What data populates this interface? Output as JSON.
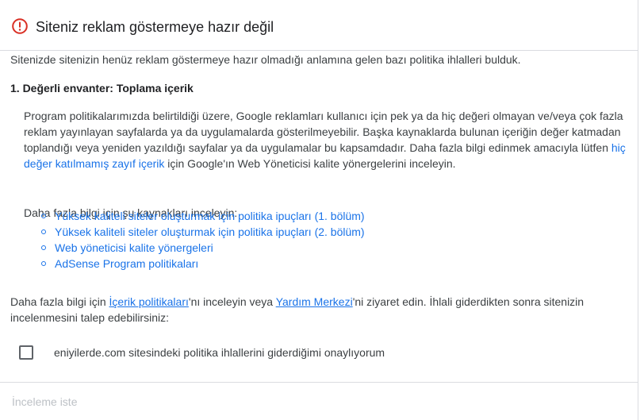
{
  "colors": {
    "alert": "#d93025",
    "link": "#1a73e8",
    "text": "#3c4043",
    "disabled": "#bdc1c6"
  },
  "header": {
    "icon": "alert-circle-icon",
    "title": "Siteniz reklam göstermeye hazır değil"
  },
  "intro": "Sitenizde sitenizin henüz reklam göstermeye hazır olmadığı anlamına gelen bazı politika ihlalleri bulduk.",
  "violation": {
    "heading": "1. Değerli envanter: Toplama içerik",
    "description_before_link": "Program politikalarımızda belirtildiği üzere, Google reklamları kullanıcı için pek ya da hiç değeri olmayan ve/veya çok fazla reklam yayınlayan sayfalarda ya da uygulamalarda gösterilmeyebilir. Başka kaynaklarda bulunan içeriğin değer katmadan toplandığı veya yeniden yazıldığı sayfalar ya da uygulamalar bu kapsamdadır. Daha fazla bilgi edinmek amacıyla lütfen ",
    "description_link": "hiç değer katılmamış zayıf içerik",
    "description_after_link": " için Google'ın Web Yöneticisi kalite yönergelerini inceleyin.",
    "resources_label": "Daha fazla bilgi için şu kaynakları inceleyin:",
    "resources": [
      "Yüksek kaliteli siteler oluşturmak için politika ipuçları (1. bölüm)",
      "Yüksek kaliteli siteler oluşturmak için politika ipuçları (2. bölüm)",
      "Web yöneticisi kalite yönergeleri",
      "AdSense Program politikaları"
    ]
  },
  "more_info": {
    "text_1": "Daha fazla bilgi için ",
    "link_1": "İçerik politikaları",
    "text_2": "'nı inceleyin veya ",
    "link_2": "Yardım Merkezi",
    "text_3": "'ni ziyaret edin. İhlali giderdikten sonra sitenizin incelenmesini talep edebilirsiniz:"
  },
  "confirm": {
    "checked": false,
    "label": "eniyilerde.com sitesindeki politika ihlallerini giderdiğimi onaylıyorum"
  },
  "footer": {
    "request_review_label": "İnceleme iste",
    "request_review_enabled": false
  }
}
